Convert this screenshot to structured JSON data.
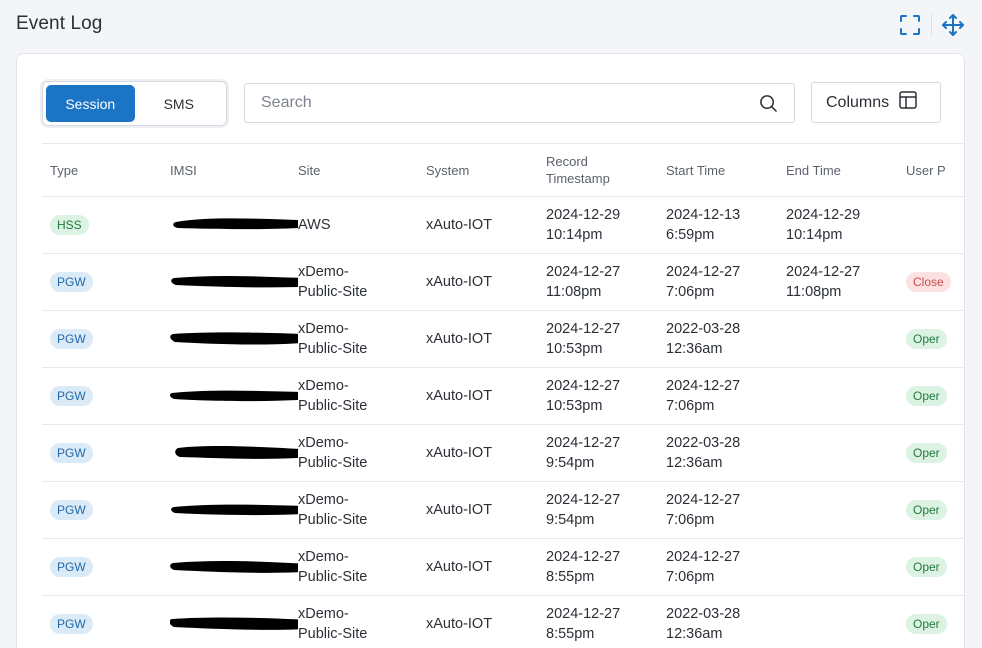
{
  "page_title": "Event Log",
  "icons": {
    "expand": "fullscreen-icon",
    "move": "move-arrows-icon",
    "search": "search-icon",
    "columns": "columns-grid-icon"
  },
  "colors": {
    "accent": "#1b75c4",
    "hss_badge_bg": "#dcf2e2",
    "pgw_badge_bg": "#dbeaf7",
    "closed_badge_bg": "#fbe1e1",
    "open_badge_bg": "#dcf2e2"
  },
  "toggle": {
    "options": [
      "Session",
      "SMS"
    ],
    "selected": "Session"
  },
  "search": {
    "placeholder": "Search",
    "value": ""
  },
  "columns_button": {
    "label": "Columns"
  },
  "table": {
    "headers": [
      "Type",
      "IMSI",
      "Site",
      "System",
      "Record Timestamp",
      "Start Time",
      "End Time",
      "User P"
    ],
    "rows": [
      {
        "type": "HSS",
        "imsi": "",
        "site_line1": "AWS",
        "site_line2": "",
        "system": "xAuto-IOT",
        "record_date": "2024-12-29",
        "record_time": "10:14pm",
        "start_date": "2024-12-13",
        "start_time": "6:59pm",
        "end_date": "2024-12-29",
        "end_time": "10:14pm",
        "user_plane": ""
      },
      {
        "type": "PGW",
        "imsi": "",
        "site_line1": "xDemo-",
        "site_line2": "Public-Site",
        "system": "xAuto-IOT",
        "record_date": "2024-12-27",
        "record_time": "11:08pm",
        "start_date": "2024-12-27",
        "start_time": "7:06pm",
        "end_date": "2024-12-27",
        "end_time": "11:08pm",
        "user_plane": "Close"
      },
      {
        "type": "PGW",
        "imsi": "",
        "site_line1": "xDemo-",
        "site_line2": "Public-Site",
        "system": "xAuto-IOT",
        "record_date": "2024-12-27",
        "record_time": "10:53pm",
        "start_date": "2022-03-28",
        "start_time": "12:36am",
        "end_date": "",
        "end_time": "",
        "user_plane": "Oper"
      },
      {
        "type": "PGW",
        "imsi": "",
        "site_line1": "xDemo-",
        "site_line2": "Public-Site",
        "system": "xAuto-IOT",
        "record_date": "2024-12-27",
        "record_time": "10:53pm",
        "start_date": "2024-12-27",
        "start_time": "7:06pm",
        "end_date": "",
        "end_time": "",
        "user_plane": "Oper"
      },
      {
        "type": "PGW",
        "imsi": "",
        "site_line1": "xDemo-",
        "site_line2": "Public-Site",
        "system": "xAuto-IOT",
        "record_date": "2024-12-27",
        "record_time": "9:54pm",
        "start_date": "2022-03-28",
        "start_time": "12:36am",
        "end_date": "",
        "end_time": "",
        "user_plane": "Oper"
      },
      {
        "type": "PGW",
        "imsi": "",
        "site_line1": "xDemo-",
        "site_line2": "Public-Site",
        "system": "xAuto-IOT",
        "record_date": "2024-12-27",
        "record_time": "9:54pm",
        "start_date": "2024-12-27",
        "start_time": "7:06pm",
        "end_date": "",
        "end_time": "",
        "user_plane": "Oper"
      },
      {
        "type": "PGW",
        "imsi": "",
        "site_line1": "xDemo-",
        "site_line2": "Public-Site",
        "system": "xAuto-IOT",
        "record_date": "2024-12-27",
        "record_time": "8:55pm",
        "start_date": "2024-12-27",
        "start_time": "7:06pm",
        "end_date": "",
        "end_time": "",
        "user_plane": "Oper"
      },
      {
        "type": "PGW",
        "imsi": "",
        "site_line1": "xDemo-",
        "site_line2": "Public-Site",
        "system": "xAuto-IOT",
        "record_date": "2024-12-27",
        "record_time": "8:55pm",
        "start_date": "2022-03-28",
        "start_time": "12:36am",
        "end_date": "",
        "end_time": "",
        "user_plane": "Oper"
      }
    ]
  }
}
